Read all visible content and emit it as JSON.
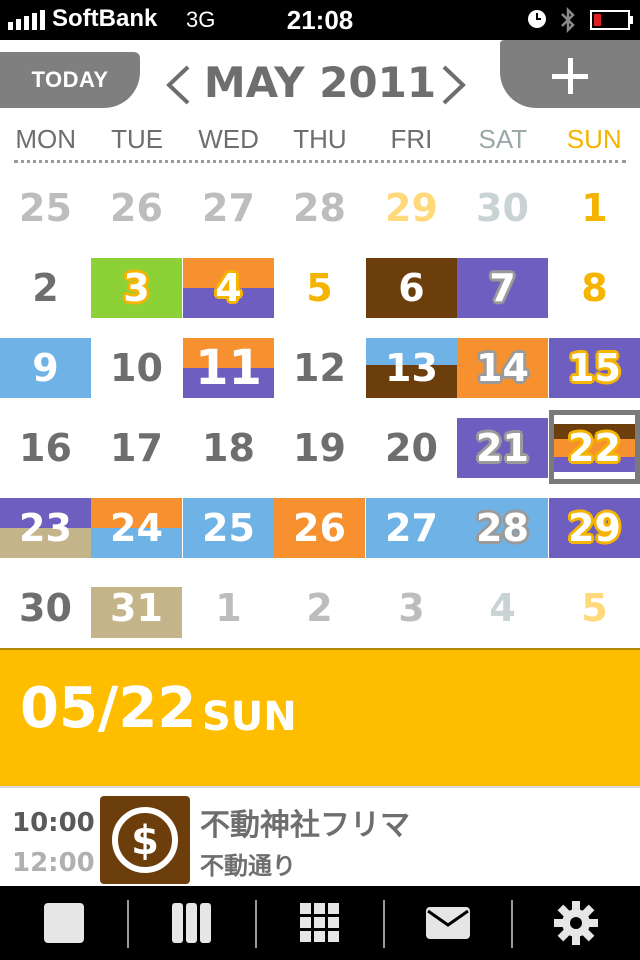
{
  "status_bar": {
    "carrier": "SoftBank",
    "network": "3G",
    "time": "21:08"
  },
  "header": {
    "today_label": "TODAY",
    "month_title": "MAY 2011"
  },
  "weekdays": [
    "MON",
    "TUE",
    "WED",
    "THU",
    "FRI",
    "SAT",
    "SUN"
  ],
  "colors": {
    "green": "#8cd136",
    "orange": "#f7902e",
    "purple": "#6e5ec0",
    "brown": "#6b3e0c",
    "blue": "#6fb2e6",
    "tan": "#c4b48a",
    "accent_yellow": "#ffbd00"
  },
  "calendar": {
    "rows": [
      [
        {
          "d": "25"
        },
        {
          "d": "26"
        },
        {
          "d": "27"
        },
        {
          "d": "28"
        },
        {
          "d": "29"
        },
        {
          "d": "30"
        },
        {
          "d": "1"
        }
      ],
      [
        {
          "d": "2"
        },
        {
          "d": "3"
        },
        {
          "d": "4"
        },
        {
          "d": "5"
        },
        {
          "d": "6"
        },
        {
          "d": "7"
        },
        {
          "d": "8"
        }
      ],
      [
        {
          "d": "9"
        },
        {
          "d": "10"
        },
        {
          "d": "11"
        },
        {
          "d": "12"
        },
        {
          "d": "13"
        },
        {
          "d": "14"
        },
        {
          "d": "15"
        }
      ],
      [
        {
          "d": "16"
        },
        {
          "d": "17"
        },
        {
          "d": "18"
        },
        {
          "d": "19"
        },
        {
          "d": "20"
        },
        {
          "d": "21"
        },
        {
          "d": "22"
        }
      ],
      [
        {
          "d": "23"
        },
        {
          "d": "24"
        },
        {
          "d": "25"
        },
        {
          "d": "26"
        },
        {
          "d": "27"
        },
        {
          "d": "28"
        },
        {
          "d": "29"
        }
      ],
      [
        {
          "d": "30"
        },
        {
          "d": "31"
        },
        {
          "d": "1"
        },
        {
          "d": "2"
        },
        {
          "d": "3"
        },
        {
          "d": "4"
        },
        {
          "d": "5"
        }
      ]
    ],
    "selected_day": "22"
  },
  "day_banner": {
    "date": "05/22",
    "weekday": "SUN"
  },
  "event": {
    "start": "10:00",
    "end": "12:00",
    "icon": "dollar-icon",
    "title": "不動神社フリマ",
    "location": "不動通り"
  },
  "toolbar": {
    "items": [
      "day-view-icon",
      "week-view-icon",
      "month-view-icon",
      "mail-icon",
      "settings-icon"
    ]
  }
}
